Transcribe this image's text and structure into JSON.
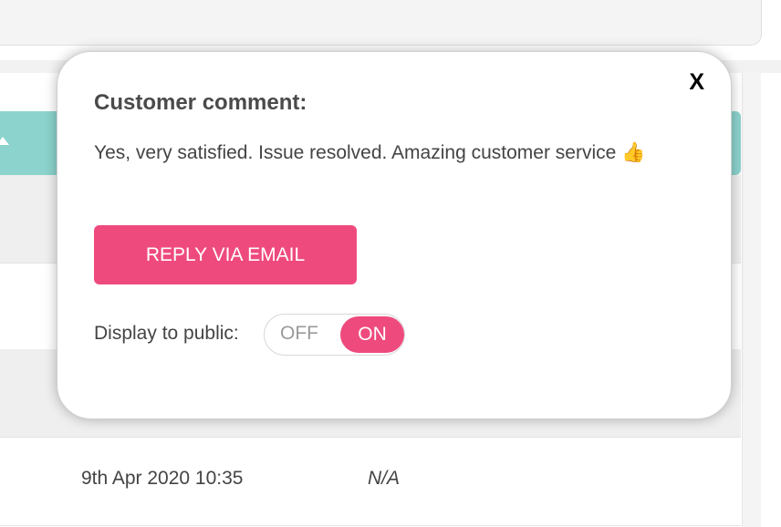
{
  "popup": {
    "title": "Customer comment:",
    "close_label": "X",
    "comment": "Yes, very satisfied. Issue resolved. Amazing customer service 👍",
    "reply_button": "REPLY VIA EMAIL",
    "display_label": "Display to public:",
    "toggle": {
      "off_label": "OFF",
      "on_label": "ON",
      "state": "ON"
    }
  },
  "table": {
    "row": {
      "date": "9th Apr 2020 10:35",
      "value": "N/A"
    }
  },
  "colors": {
    "accent": "#ee4a7e",
    "header_teal": "#8dd3cd"
  }
}
